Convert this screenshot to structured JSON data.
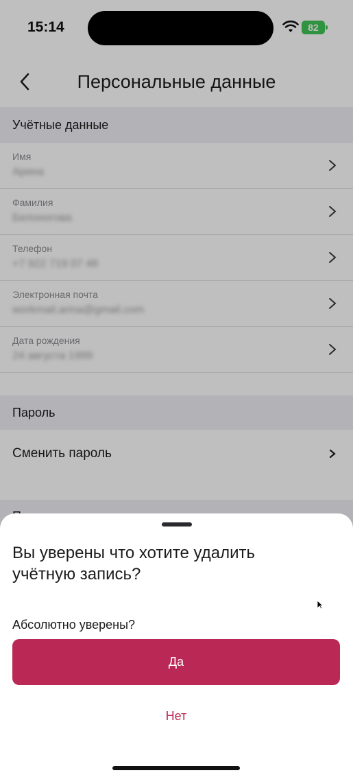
{
  "status": {
    "time": "15:14",
    "battery": "82"
  },
  "nav": {
    "title": "Персональные данные"
  },
  "account": {
    "header": "Учётные данные",
    "rows": [
      {
        "label": "Имя",
        "value": "Арина"
      },
      {
        "label": "Фамилия",
        "value": "Белоногова"
      },
      {
        "label": "Телефон",
        "value": "+7 922 719 07 48"
      },
      {
        "label": "Электронная почта",
        "value": "workmail.arina@gmail.com"
      },
      {
        "label": "Дата рождения",
        "value": "24 августа 1999"
      }
    ]
  },
  "password": {
    "header": "Пароль",
    "change_label": "Сменить пароль"
  },
  "newsletter": {
    "header": "Подписка на рассылки"
  },
  "sheet": {
    "title": "Вы уверены что хотите удалить учётную запись?",
    "subtitle": "Абсолютно уверены?",
    "yes_label": "Да",
    "no_label": "Нет"
  },
  "colors": {
    "accent": "#ba2955",
    "battery": "#3fc455"
  }
}
